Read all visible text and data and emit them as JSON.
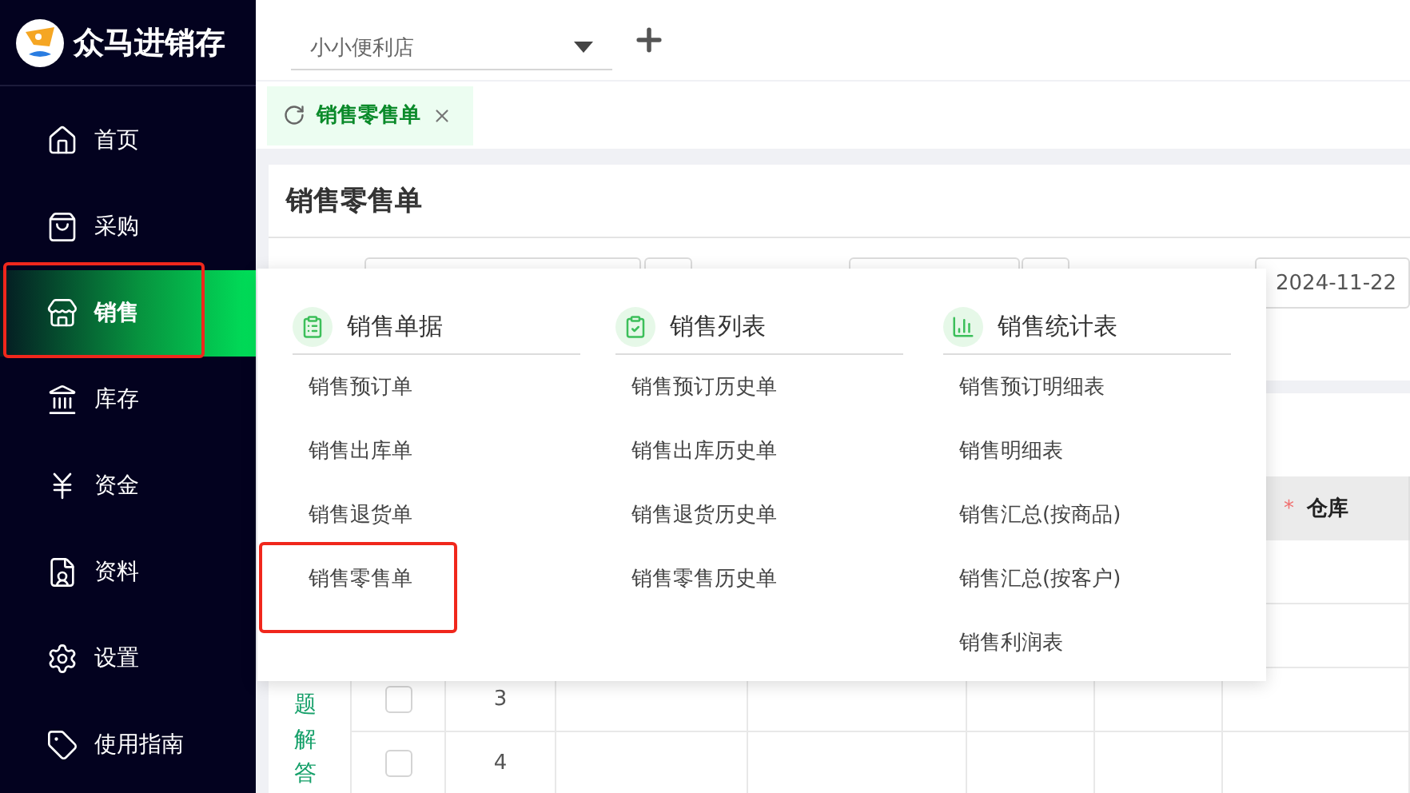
{
  "app": {
    "name": "众马进销存"
  },
  "sidebar": {
    "items": [
      {
        "label": "首页",
        "selected": false,
        "highlighted": false
      },
      {
        "label": "采购",
        "selected": false,
        "highlighted": false
      },
      {
        "label": "销售",
        "selected": true,
        "highlighted": true
      },
      {
        "label": "库存",
        "selected": false,
        "highlighted": false
      },
      {
        "label": "资金",
        "selected": false,
        "highlighted": false
      },
      {
        "label": "资料",
        "selected": false,
        "highlighted": false
      },
      {
        "label": "设置",
        "selected": false,
        "highlighted": false
      },
      {
        "label": "使用指南",
        "selected": false,
        "highlighted": false
      }
    ]
  },
  "store_select": {
    "value": "小小便利店"
  },
  "tabs": [
    {
      "label": "销售零售单",
      "selected": true
    }
  ],
  "page": {
    "title": "销售零售单",
    "date_field": {
      "value": "2024-11-22"
    }
  },
  "side_note": "题解答",
  "table": {
    "columns": [
      {
        "mark": "*",
        "label": "仓库"
      }
    ],
    "rows": [
      {
        "number": "3",
        "checked": false
      },
      {
        "number": "4",
        "checked": false
      }
    ]
  },
  "menu": {
    "groups": [
      {
        "title": "销售单据",
        "items": [
          {
            "label": "销售预订单",
            "highlighted": false
          },
          {
            "label": "销售出库单",
            "highlighted": false
          },
          {
            "label": "销售退货单",
            "highlighted": false
          },
          {
            "label": "销售零售单",
            "highlighted": true
          }
        ]
      },
      {
        "title": "销售列表",
        "items": [
          {
            "label": "销售预订历史单",
            "highlighted": false
          },
          {
            "label": "销售出库历史单",
            "highlighted": false
          },
          {
            "label": "销售退货历史单",
            "highlighted": false
          },
          {
            "label": "销售零售历史单",
            "highlighted": false
          }
        ]
      },
      {
        "title": "销售统计表",
        "items": [
          {
            "label": "销售预订明细表",
            "highlighted": false
          },
          {
            "label": "销售明细表",
            "highlighted": false
          },
          {
            "label": "销售汇总(按商品)",
            "highlighted": false
          },
          {
            "label": "销售汇总(按客户)",
            "highlighted": false
          },
          {
            "label": "销售利润表",
            "highlighted": false
          }
        ]
      }
    ]
  }
}
